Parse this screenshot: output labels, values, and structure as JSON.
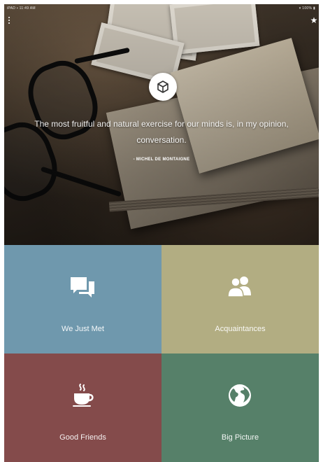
{
  "status_bar": {
    "left_text": "iPAD ▪ 11:49 AM",
    "right_text": "▾ 100% ▮"
  },
  "header": {
    "menu_icon": "vertical-dots-icon",
    "favorite_icon": "star-icon",
    "logo_icon": "cube-icon"
  },
  "quote": {
    "text": "The most fruitful and natural exercise for our minds is, in my opinion, conversation.",
    "author": "- MICHEL DE MONTAIGNE"
  },
  "categories": [
    {
      "label": "We Just Met",
      "icon": "speech-bubbles-icon",
      "color": "#6f98ad"
    },
    {
      "label": "Acquaintances",
      "icon": "people-icon",
      "color": "#b2ad82"
    },
    {
      "label": "Good Friends",
      "icon": "coffee-cup-icon",
      "color": "#844b4b"
    },
    {
      "label": "Big Picture",
      "icon": "globe-icon",
      "color": "#568069"
    }
  ]
}
